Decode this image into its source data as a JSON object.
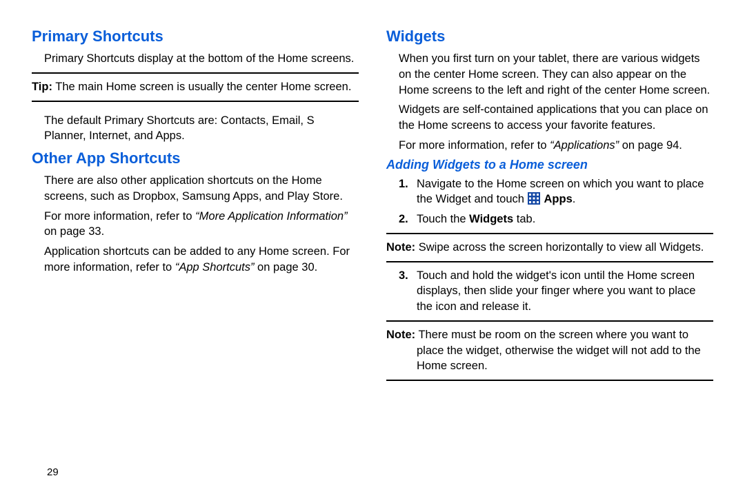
{
  "pageNumber": "29",
  "left": {
    "h_primary": "Primary Shortcuts",
    "primary_p1": "Primary Shortcuts display at the bottom of the Home screens.",
    "tip_label": "Tip:",
    "tip_text": " The main Home screen is usually the center Home screen.",
    "primary_p2": "The default Primary Shortcuts are: Contacts, Email, S Planner,  Internet, and Apps.",
    "h_other": "Other App Shortcuts",
    "other_p1": "There are also other application shortcuts on the Home screens, such as Dropbox, Samsung Apps, and Play Store.",
    "other_p2a": "For more information, refer to ",
    "other_p2_ref": "“More Application Information”",
    "other_p2b": " on page 33.",
    "other_p3a": "Application shortcuts can be added to any Home screen. For more information, refer to ",
    "other_p3_ref": "“App Shortcuts”",
    "other_p3b": " on page 30."
  },
  "right": {
    "h_widgets": "Widgets",
    "w_p1": "When you first turn on your tablet, there are various widgets on the center Home screen. They can also appear on the Home screens to the left and right of the center Home screen.",
    "w_p2": "Widgets are self-contained applications that you can place on the Home screens to access your favorite features.",
    "w_p3a": "For more information, refer to ",
    "w_p3_ref": "“Applications”",
    "w_p3b": " on page 94.",
    "h_add": "Adding Widgets to a Home screen",
    "step1_num": "1.",
    "step1a": "Navigate to the Home screen on which you want to place the Widget and touch ",
    "step1_apps": " Apps",
    "step1b": ".",
    "step2_num": "2.",
    "step2a": "Touch the ",
    "step2_bold": "Widgets",
    "step2b": " tab.",
    "note1_label": "Note:",
    "note1_text": " Swipe across the screen horizontally to view all Widgets.",
    "step3_num": "3.",
    "step3": "Touch and hold the widget's icon until the Home screen displays, then slide your finger where you want to place the icon and release it.",
    "note2_label": "Note:",
    "note2_text": " There must be room on the screen where you want to place the widget, otherwise the widget will not add to the Home screen."
  }
}
